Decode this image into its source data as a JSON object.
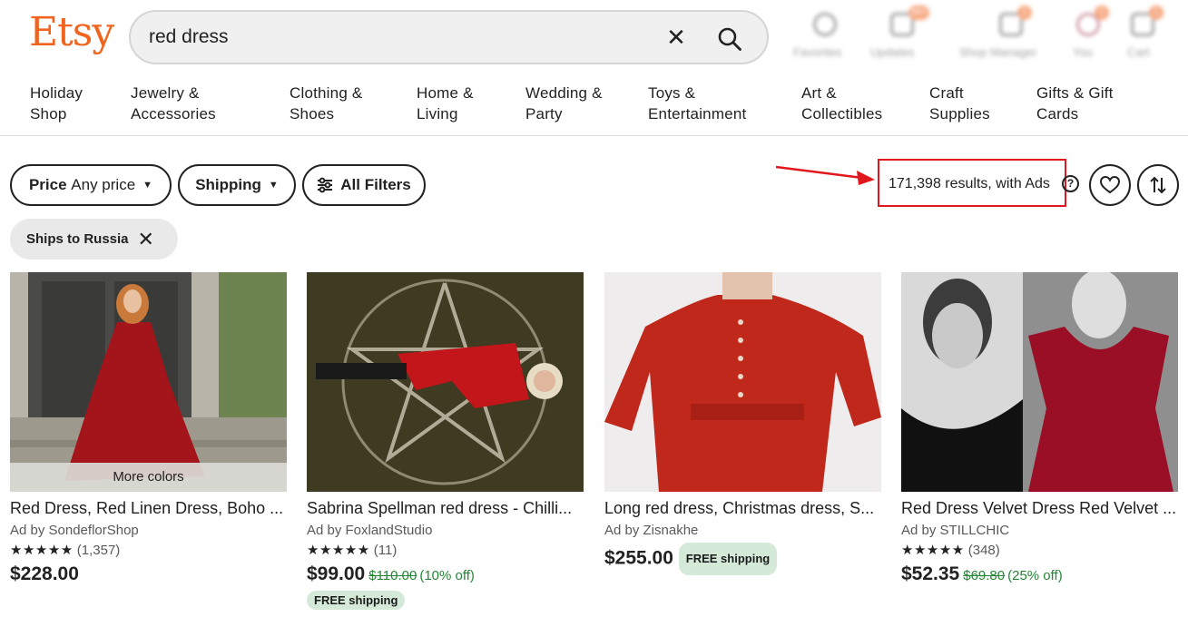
{
  "header": {
    "logo": "Etsy",
    "search_value": "red dress",
    "clear_glyph": "✕",
    "icons": [
      {
        "name": "favorites-icon",
        "label": "Favorites",
        "badge": ""
      },
      {
        "name": "updates-icon",
        "label": "Updates",
        "badge": "99+"
      },
      {
        "name": "shop-manager-icon",
        "label": "Shop Manager",
        "badge": "1"
      },
      {
        "name": "you-icon",
        "label": "You",
        "badge": "1"
      },
      {
        "name": "cart-icon",
        "label": "Cart",
        "badge": "1"
      }
    ]
  },
  "categories": [
    {
      "line1": "Holiday",
      "line2": "Shop"
    },
    {
      "line1": "Jewelry &",
      "line2": "Accessories"
    },
    {
      "line1": "Clothing &",
      "line2": "Shoes"
    },
    {
      "line1": "Home &",
      "line2": "Living"
    },
    {
      "line1": "Wedding &",
      "line2": "Party"
    },
    {
      "line1": "Toys &",
      "line2": "Entertainment"
    },
    {
      "line1": "Art &",
      "line2": "Collectibles"
    },
    {
      "line1": "Craft",
      "line2": "Supplies"
    },
    {
      "line1": "Gifts & Gift",
      "line2": "Cards"
    }
  ],
  "filters": {
    "price_label": "Price",
    "price_value": "Any price",
    "shipping_label": "Shipping",
    "all_filters_label": "All Filters",
    "results_text": "171,398 results, with Ads",
    "help_glyph": "?",
    "chip_label": "Ships to Russia",
    "chip_remove": "✕"
  },
  "annotation_color": "#e0181e",
  "products": [
    {
      "title": "Red Dress, Red Linen Dress, Boho ...",
      "overlay": "More colors",
      "shop": "Ad by SondeflorShop",
      "stars": "★★★★★",
      "reviews": "(1,357)",
      "price": "$228.00",
      "original_price": "",
      "discount": "",
      "free_shipping": ""
    },
    {
      "title": "Sabrina Spellman red dress - Chilli...",
      "overlay": "",
      "shop": "Ad by FoxlandStudio",
      "stars": "★★★★★",
      "reviews": "(11)",
      "price": "$99.00",
      "original_price": "$110.00",
      "discount": "(10% off)",
      "free_shipping": "FREE shipping"
    },
    {
      "title": "Long red dress, Christmas dress, S...",
      "overlay": "",
      "shop": "Ad by Zisnakhe",
      "stars": "",
      "reviews": "",
      "price": "$255.00",
      "original_price": "",
      "discount": "",
      "free_shipping": "FREE shipping"
    },
    {
      "title": "Red Dress Velvet Dress Red Velvet ...",
      "overlay": "",
      "shop": "Ad by STILLCHIC",
      "stars": "★★★★★",
      "reviews": "(348)",
      "price": "$52.35",
      "original_price": "$69.80",
      "discount": "(25% off)",
      "free_shipping": ""
    }
  ]
}
